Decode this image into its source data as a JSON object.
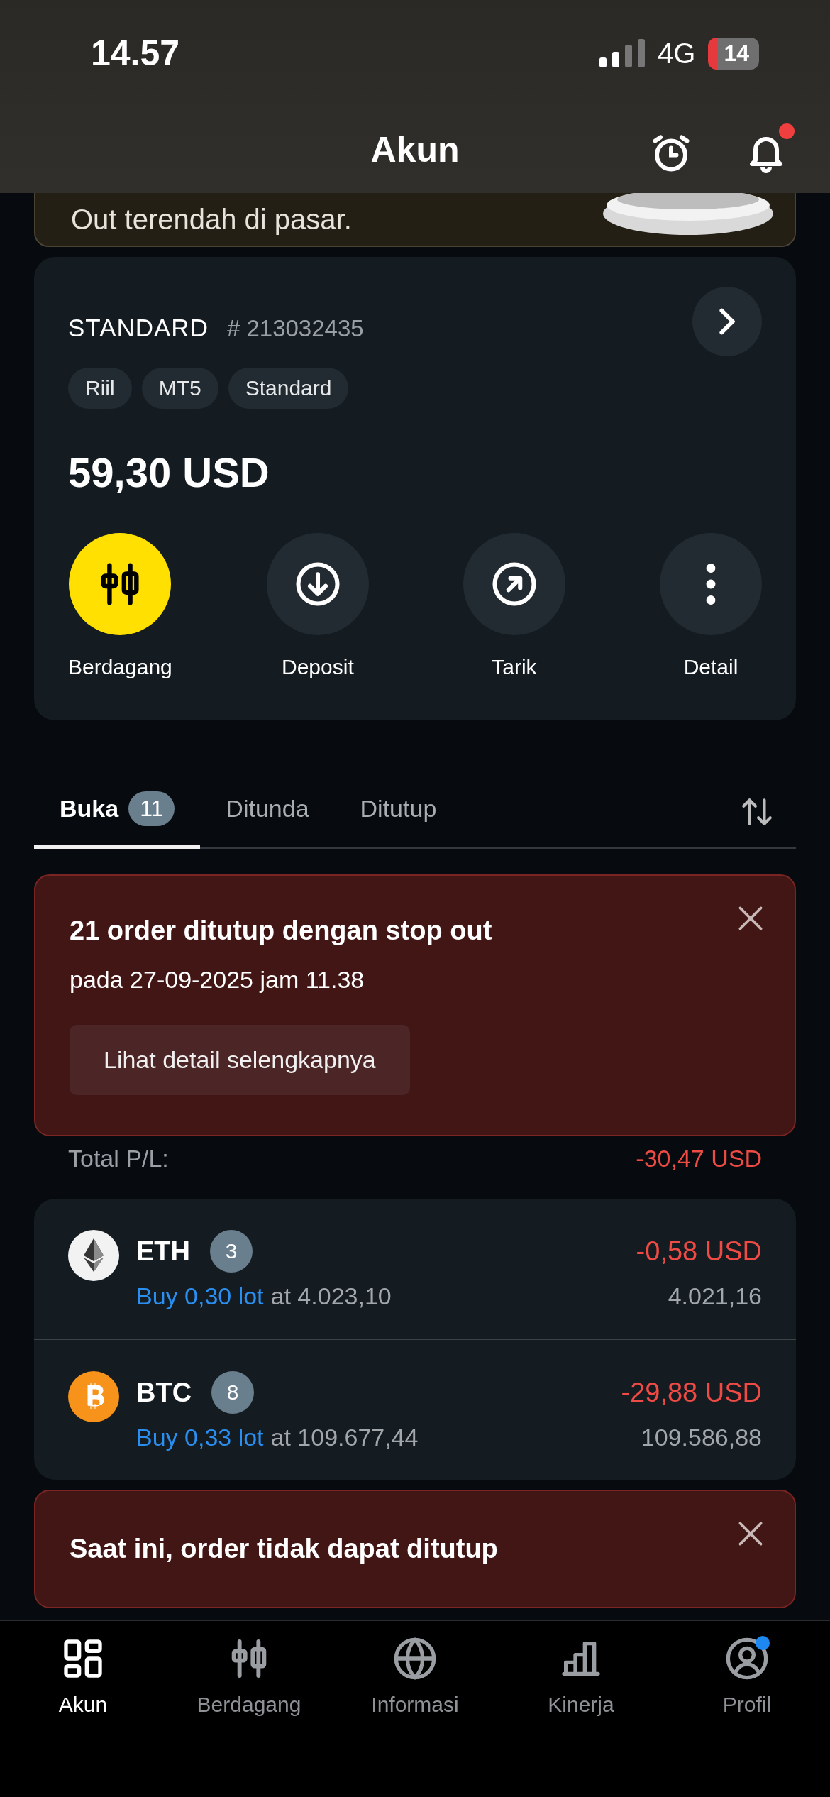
{
  "status_bar": {
    "time": "14.57",
    "network": "4G",
    "battery": "14"
  },
  "header": {
    "title": "Akun",
    "notification_unread": true
  },
  "promo": {
    "text": "Out terendah di pasar.",
    "kind": "picture"
  },
  "account": {
    "type": "STANDARD",
    "number": "# 213032435",
    "tags": [
      "Riil",
      "MT5",
      "Standard"
    ],
    "balance": "59,30 USD",
    "actions": [
      {
        "label": "Berdagang",
        "kind": "trade",
        "highlighted": true
      },
      {
        "label": "Deposit",
        "kind": "deposit",
        "highlighted": false
      },
      {
        "label": "Tarik",
        "kind": "withdraw",
        "highlighted": false
      },
      {
        "label": "Detail",
        "kind": "more",
        "highlighted": false
      }
    ]
  },
  "tabs": [
    {
      "label": "Buka",
      "count": "11",
      "selected": true
    },
    {
      "label": "Ditunda",
      "selected": false
    },
    {
      "label": "Ditutup",
      "selected": false
    }
  ],
  "stop_out_alert": {
    "title": "21 order ditutup dengan stop out",
    "subtitle": "pada 27-09-2025 jam 11.38",
    "button": "Lihat detail selengkapnya"
  },
  "total_pl": {
    "label": "Total P/L:",
    "value": "-30,47 USD"
  },
  "positions": [
    {
      "kind": "eth",
      "symbol": "ETH",
      "count": "3",
      "order": "Buy 0,30 lot",
      "entry": "at 4.023,10",
      "pl": "-0,58 USD",
      "price": "4.021,16"
    },
    {
      "kind": "btc",
      "symbol": "BTC",
      "count": "8",
      "order": "Buy 0,33 lot",
      "entry": "at 109.677,44",
      "pl": "-29,88 USD",
      "price": "109.586,88"
    }
  ],
  "close_alert": {
    "title": "Saat ini, order tidak dapat ditutup"
  },
  "nav": [
    {
      "label": "Akun",
      "selected": true,
      "badge": false
    },
    {
      "label": "Berdagang",
      "selected": false,
      "badge": false
    },
    {
      "label": "Informasi",
      "selected": false,
      "badge": false
    },
    {
      "label": "Kinerja",
      "selected": false,
      "badge": false
    },
    {
      "label": "Profil",
      "selected": false,
      "badge": true
    }
  ]
}
